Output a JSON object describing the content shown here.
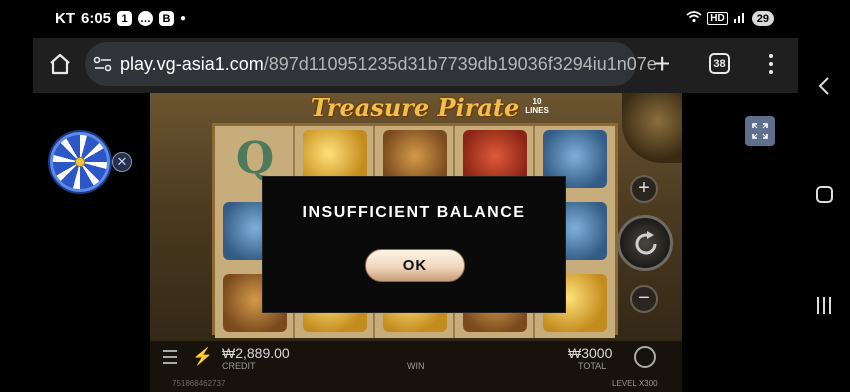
{
  "status_bar": {
    "carrier": "KT",
    "time": "6:05",
    "notif_badge": "1",
    "notif_b": "B",
    "battery": "29",
    "signal_text": "HD"
  },
  "browser": {
    "url_host": "play.vg-asia1.com",
    "url_path": "/897d110951235d31b7739db19036f3294iu1n07e",
    "tab_count": "38",
    "icons": [
      "home-icon",
      "site-settings-icon",
      "plus-icon",
      "tabs-icon",
      "more-vert-icon"
    ]
  },
  "game": {
    "title": "Treasure Pirate",
    "lines_num": "10",
    "lines_label": "LINES",
    "letter_q": "Q",
    "credit_value": "₩2,889.00",
    "credit_label": "CREDIT",
    "win_label": "WIN",
    "total_value": "₩3000",
    "total_label": "TOTAL",
    "round_id": "751868462737",
    "level_label": "LEVEL",
    "level_value": "X300"
  },
  "modal": {
    "title": "INSUFFICIENT BALANCE",
    "ok_label": "OK"
  },
  "widget": {
    "close_glyph": "✕"
  },
  "colors": {
    "modal_bg": "#0a0a0a",
    "ok_button": "#f0d7bd",
    "toolbar": "#1f1f1f",
    "urlbar": "#303338"
  }
}
